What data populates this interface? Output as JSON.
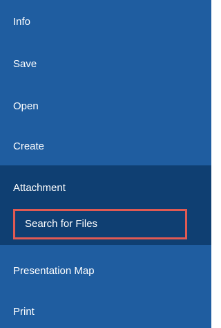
{
  "menu": {
    "info_label": "Info",
    "save_label": "Save",
    "open_label": "Open",
    "create_label": "Create",
    "attachment_label": "Attachment",
    "search_files_label": "Search for Files",
    "presentation_map_label": "Presentation Map",
    "print_label": "Print"
  },
  "colors": {
    "menu_background": "#1f5da0",
    "selected_group_background": "#0f3f72",
    "highlight_border": "#e05a53",
    "text": "#ffffff"
  }
}
